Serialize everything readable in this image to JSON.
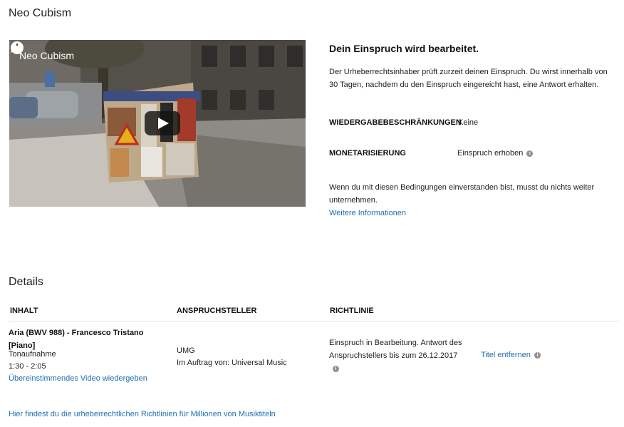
{
  "page_title": "Neo Cubism",
  "video": {
    "title": "Neo Cubism"
  },
  "status": {
    "heading": "Dein Einspruch wird bearbeitet.",
    "description": "Der Urheberrechtsinhaber prüft zurzeit deinen Einspruch. Du wirst innerhalb von 30 Tagen, nachdem du den Einspruch eingereicht hast, eine Antwort erhalten.",
    "playback_label": "WIEDERGABEBESCHRÄNKUNGEN",
    "playback_value": "Keine",
    "monetization_label": "MONETARISIERUNG",
    "monetization_value": "Einspruch erhoben",
    "note": "Wenn du mit diesen Bedingungen einverstanden bist, musst du nichts weiter unternehmen.",
    "more_info_link": "Weitere Informationen"
  },
  "details": {
    "title": "Details",
    "headers": {
      "content": "INHALT",
      "claimant": "ANSPRUCHSTELLER",
      "policy": "RICHTLINIE"
    },
    "row": {
      "content_title": "Aria (BWV 988) - Francesco Tristano [Piano]",
      "content_type": "Tonaufnahme",
      "content_time": "1:30 - 2:05",
      "content_link": "Übereinstimmendes Video wiedergeben",
      "claimant_name": "UMG",
      "claimant_on_behalf": "Im Auftrag von: Universal Music",
      "policy_text": "Einspruch in Bearbeitung. Antwort des Anspruchstellers bis zum 26.12.2017",
      "action_link": "Titel entfernen"
    }
  },
  "footer_link": "Hier findest du die urheberrechtlichen Richtlinien für Millionen von Musiktiteln"
}
